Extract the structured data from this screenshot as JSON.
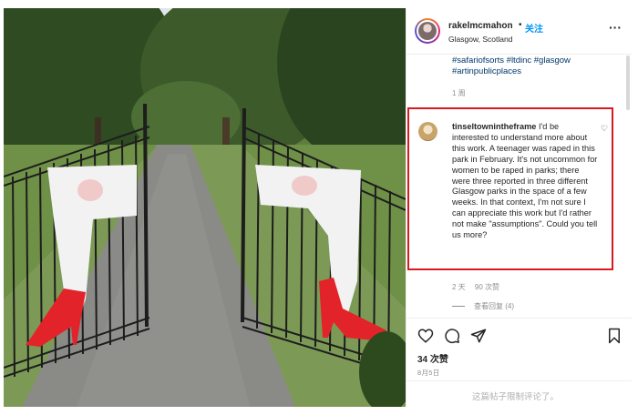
{
  "post": {
    "username": "rakelmcmahon",
    "separator": "•",
    "follow_label": "关注",
    "location": "Glasgow, Scotland",
    "more_icon": "more-horizontal-icon",
    "hashtags": "#safariofsorts #ltdinc #glasgow #artinpublicplaces",
    "caption_time": "1 周"
  },
  "comment": {
    "username": "tinseltownintheframe",
    "text": "I'd be interested to understand more about this work. A teenager was raped in this park in February. It's not uncommon for women to be raped in parks; there were three reported in three different Glasgow parks in the space of a few weeks. In that context, I'm not sure I can appreciate this work but I'd rather not make \"assumptions\". Could you tell us more?",
    "age": "2 天",
    "likes": "90 次赞",
    "replies_label": "查看回复 (4)"
  },
  "actions": {
    "like_icon": "heart-icon",
    "comment_icon": "comment-icon",
    "share_icon": "share-icon",
    "save_icon": "bookmark-icon"
  },
  "stats": {
    "likes": "34 次赞",
    "date": "8月5日"
  },
  "footer": {
    "limited_text": "这篇帖子限制评论了。"
  },
  "colors": {
    "accent": "#0095f6",
    "highlight_box": "#d71920",
    "heel_red": "#e2232a"
  }
}
